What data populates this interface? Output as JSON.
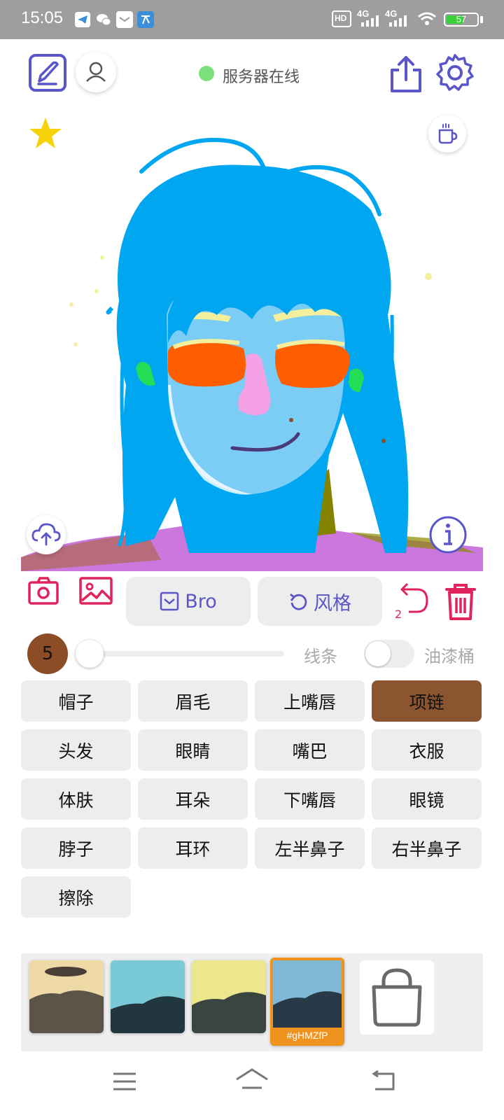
{
  "status_bar": {
    "time": "15:05",
    "hd_label": "HD",
    "net1": "4G",
    "net2": "4G",
    "battery": "57"
  },
  "header": {
    "server_status": "服务器在线",
    "server_status_color": "#7be07b",
    "accent_color": "#5a55c8"
  },
  "toolbar": {
    "bro_label": "Bro",
    "style_label": "风格",
    "undo_count": "2"
  },
  "brush": {
    "size": "5",
    "color": "#8b4c26",
    "line_label": "线条",
    "bucket_label": "油漆桶"
  },
  "categories": [
    {
      "label": "帽子",
      "active": false
    },
    {
      "label": "眉毛",
      "active": false
    },
    {
      "label": "上嘴唇",
      "active": false
    },
    {
      "label": "项链",
      "active": true
    },
    {
      "label": "头发",
      "active": false
    },
    {
      "label": "眼睛",
      "active": false
    },
    {
      "label": "嘴巴",
      "active": false
    },
    {
      "label": "衣服",
      "active": false
    },
    {
      "label": "体肤",
      "active": false
    },
    {
      "label": "耳朵",
      "active": false
    },
    {
      "label": "下嘴唇",
      "active": false
    },
    {
      "label": "眼镜",
      "active": false
    },
    {
      "label": "脖子",
      "active": false
    },
    {
      "label": "耳环",
      "active": false
    },
    {
      "label": "左半鼻子",
      "active": false
    },
    {
      "label": "右半鼻子",
      "active": false
    },
    {
      "label": "擦除",
      "active": false
    }
  ],
  "styles": {
    "selected_code": "#gHMZfP"
  }
}
